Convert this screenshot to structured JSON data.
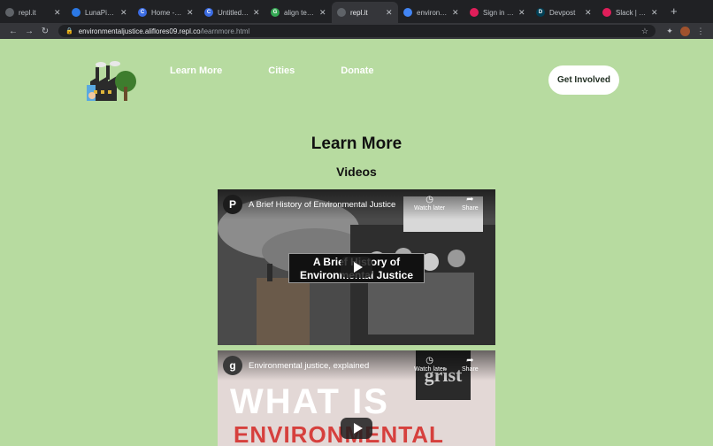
{
  "browser": {
    "tabs": [
      {
        "title": "repl.it",
        "icon": "replit-icon",
        "color": "#5f6368",
        "glyph": ""
      },
      {
        "title": "LunaPic | Fr",
        "icon": "lunapic-icon",
        "color": "#2b78e4",
        "glyph": ""
      },
      {
        "title": "Home - Can",
        "icon": "canva-icon",
        "color": "#3b6ce3",
        "glyph": "C"
      },
      {
        "title": "Untitled des",
        "icon": "canva-icon",
        "color": "#3b6ce3",
        "glyph": "C"
      },
      {
        "title": "align text lef",
        "icon": "google-icon",
        "color": "#34a853",
        "glyph": "G"
      },
      {
        "title": "repl.it",
        "icon": "replit-icon",
        "color": "#5f6368",
        "glyph": "",
        "active": true
      },
      {
        "title": "environmen",
        "icon": "docs-icon",
        "color": "#4285f4",
        "glyph": ""
      },
      {
        "title": "Sign in | Sla",
        "icon": "slack-icon",
        "color": "#e01e5a",
        "glyph": ""
      },
      {
        "title": "Devpost",
        "icon": "devpost-icon",
        "color": "#003e54",
        "glyph": "D"
      },
      {
        "title": "Slack | ! Kim",
        "icon": "slack-icon",
        "color": "#e01e5a",
        "glyph": ""
      }
    ],
    "url_host": "environmentaljustice.aliflores09.repl.co",
    "url_path": "/learnmore.html"
  },
  "site": {
    "nav": [
      "Learn More",
      "Cities",
      "Donate"
    ],
    "cta_label": "Get Involved",
    "page_title": "Learn More",
    "section_title": "Videos"
  },
  "videos": [
    {
      "title": "A Brief History of Environmental Justice",
      "channel_glyph": "P",
      "channel_color": "#1c1c1c",
      "caption": "A Brief History of Environmental Justice",
      "watch_later": "Watch later",
      "share": "Share"
    },
    {
      "title": "Environmental justice, explained",
      "channel_glyph": "g",
      "channel_color": "#3a3a3a",
      "thumb_text_1": "WHAT IS",
      "thumb_text_2": "ENVIRONMENTAL",
      "brand_text": "grist",
      "watch_later": "Watch later",
      "share": "Share"
    }
  ],
  "colors": {
    "page_bg": "#b7dba0",
    "cta_bg": "#ffffff"
  }
}
